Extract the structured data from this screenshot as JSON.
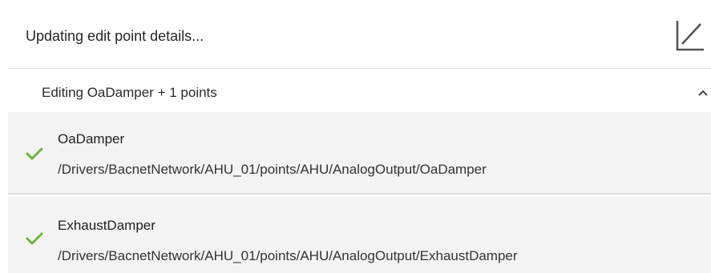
{
  "header": {
    "title": "Updating edit point details...",
    "expand_icon": "expand-diagonal-icon"
  },
  "section": {
    "title": "Editing OaDamper + 1 points",
    "toggle_icon": "chevron-up-icon"
  },
  "points": [
    {
      "status_icon": "checkmark-icon",
      "name": "OaDamper",
      "path": "/Drivers/BacnetNetwork/AHU_01/points/AHU/AnalogOutput/OaDamper"
    },
    {
      "status_icon": "checkmark-icon",
      "name": "ExhaustDamper",
      "path": "/Drivers/BacnetNetwork/AHU_01/points/AHU/AnalogOutput/ExhaustDamper"
    }
  ],
  "colors": {
    "success": "#6cb33f",
    "item_background": "#f3f3f3",
    "divider": "#e4e4e4"
  }
}
